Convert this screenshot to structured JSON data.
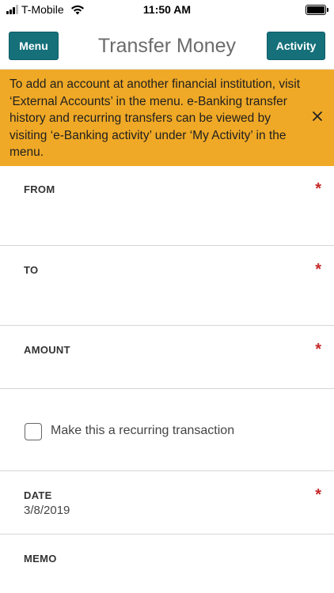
{
  "status_bar": {
    "carrier": "T-Mobile",
    "time": "11:50 AM",
    "signal_bars_active": 3,
    "battery_level": 1.0
  },
  "header": {
    "menu_label": "Menu",
    "title": "Transfer Money",
    "activity_label": "Activity",
    "accent_color": "#15707a"
  },
  "banner": {
    "text": "To add an account at another financial institution, visit ‘External Accounts’ in the menu. e-Banking transfer history and recurring transfers can be viewed by visiting ‘e-Banking activity’ under ‘My Activity’ in the menu.",
    "background_color": "#f0a926",
    "close_icon": "close-icon"
  },
  "form": {
    "from": {
      "label": "FROM",
      "required_mark": "*",
      "value": ""
    },
    "to": {
      "label": "TO",
      "required_mark": "*",
      "value": ""
    },
    "amount": {
      "label": "AMOUNT",
      "required_mark": "*",
      "value": ""
    },
    "recurring": {
      "label": "Make this a recurring transaction",
      "checked": false
    },
    "date": {
      "label": "DATE",
      "required_mark": "*",
      "value": "3/8/2019"
    },
    "memo": {
      "label": "MEMO",
      "value": ""
    }
  }
}
